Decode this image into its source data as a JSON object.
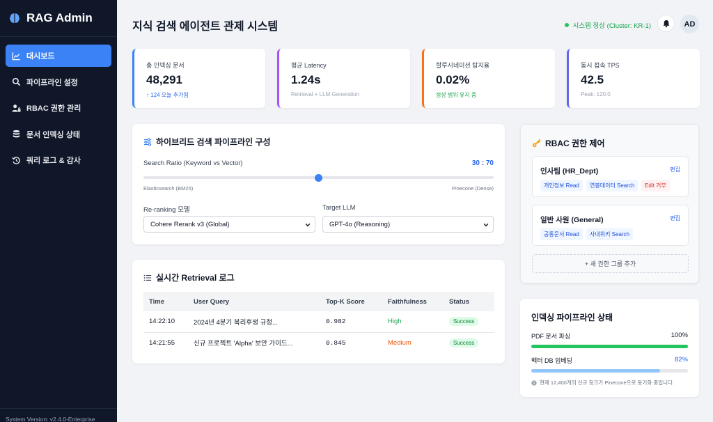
{
  "sidebar": {
    "brand": "RAG Admin",
    "items": [
      {
        "label": "대시보드",
        "icon": "chart-line-icon",
        "active": true
      },
      {
        "label": "파이프라인 설정",
        "icon": "search-icon",
        "active": false
      },
      {
        "label": "RBAC 권한 관리",
        "icon": "user-lock-icon",
        "active": false
      },
      {
        "label": "문서 인덱싱 상태",
        "icon": "database-icon",
        "active": false
      },
      {
        "label": "쿼리 로그 & 감사",
        "icon": "history-icon",
        "active": false
      }
    ],
    "footer": "System Version: v2.4.0-Enterprise"
  },
  "header": {
    "title": "지식 검색 에이전트 관제 시스템",
    "status": "시스템 정상 (Cluster: KR-1)",
    "avatar": "AD"
  },
  "kpis": [
    {
      "label": "총 인덱싱 문서",
      "value": "48,291",
      "sub": "↑ 124 오늘 추가됨",
      "accent": "#3b82f6",
      "sub_color": "#2563eb"
    },
    {
      "label": "평균 Latency",
      "value": "1.24s",
      "sub": "Retrieval + LLM Generation",
      "accent": "#a855f7",
      "sub_color": "#9ca3af"
    },
    {
      "label": "할루시네이션 탐지율",
      "value": "0.02%",
      "sub": "정상 범위 유지 중",
      "accent": "#f97316",
      "sub_color": "#16a34a"
    },
    {
      "label": "동시 접속 TPS",
      "value": "42.5",
      "sub": "Peak: 120.0",
      "accent": "#6366f1",
      "sub_color": "#9ca3af"
    }
  ],
  "pipeline": {
    "title": "하이브리드 검색 파이프라인 구성",
    "ratio_label": "Search Ratio (Keyword vs Vector)",
    "ratio_value": "30 : 70",
    "slider_fraction": 0.5,
    "left_end": "Elasticsearch (BM25)",
    "right_end": "Pinecone (Dense)",
    "rerank_label": "Re-ranking 모델",
    "rerank_value": "Cohere Rerank v3 (Global)",
    "llm_label": "Target LLM",
    "llm_value": "GPT-4o (Reasoning)"
  },
  "retrieval": {
    "title": "실시간 Retrieval 로그",
    "columns": [
      "Time",
      "User Query",
      "Top-K Score",
      "Faithfulness",
      "Status"
    ],
    "rows": [
      {
        "time": "14:22:10",
        "query": "2024년 4분기 복리후생 규정...",
        "score": "0.982",
        "faith": "High",
        "faith_color": "#16a34a",
        "status": "Success"
      },
      {
        "time": "14:21:55",
        "query": "신규 프로젝트 'Alpha' 보안 가이드...",
        "score": "0.845",
        "faith": "Medium",
        "faith_color": "#ea580c",
        "status": "Success"
      }
    ]
  },
  "rbac": {
    "title": "RBAC 권한 제어",
    "roles": [
      {
        "name": "인사팀 (HR_Dept)",
        "edit": "편집",
        "tags": [
          {
            "label": "개인정보 Read",
            "tone": "blue"
          },
          {
            "label": "연봉데이터 Search",
            "tone": "blue"
          },
          {
            "label": "Edit 거부",
            "tone": "red"
          }
        ]
      },
      {
        "name": "일반 사원 (General)",
        "edit": "편집",
        "tags": [
          {
            "label": "공통문서 Read",
            "tone": "blue"
          },
          {
            "label": "사내위키 Search",
            "tone": "blue"
          }
        ]
      }
    ],
    "add_label": "+ 새 권한 그룹 추가"
  },
  "indexing": {
    "title": "인덱싱 파이프라인 상태",
    "items": [
      {
        "label": "PDF 문서 파싱",
        "percent": "100%",
        "fraction": 1.0,
        "color": "#22c55e",
        "percent_color": "#111827"
      },
      {
        "label": "벡터 DB 임베딩",
        "percent": "82%",
        "fraction": 0.82,
        "color": "#93c5fd",
        "percent_color": "#2563eb"
      }
    ],
    "note": "현재 12,400개의 신규 청크가 Pinecone으로 동기화 중입니다."
  }
}
